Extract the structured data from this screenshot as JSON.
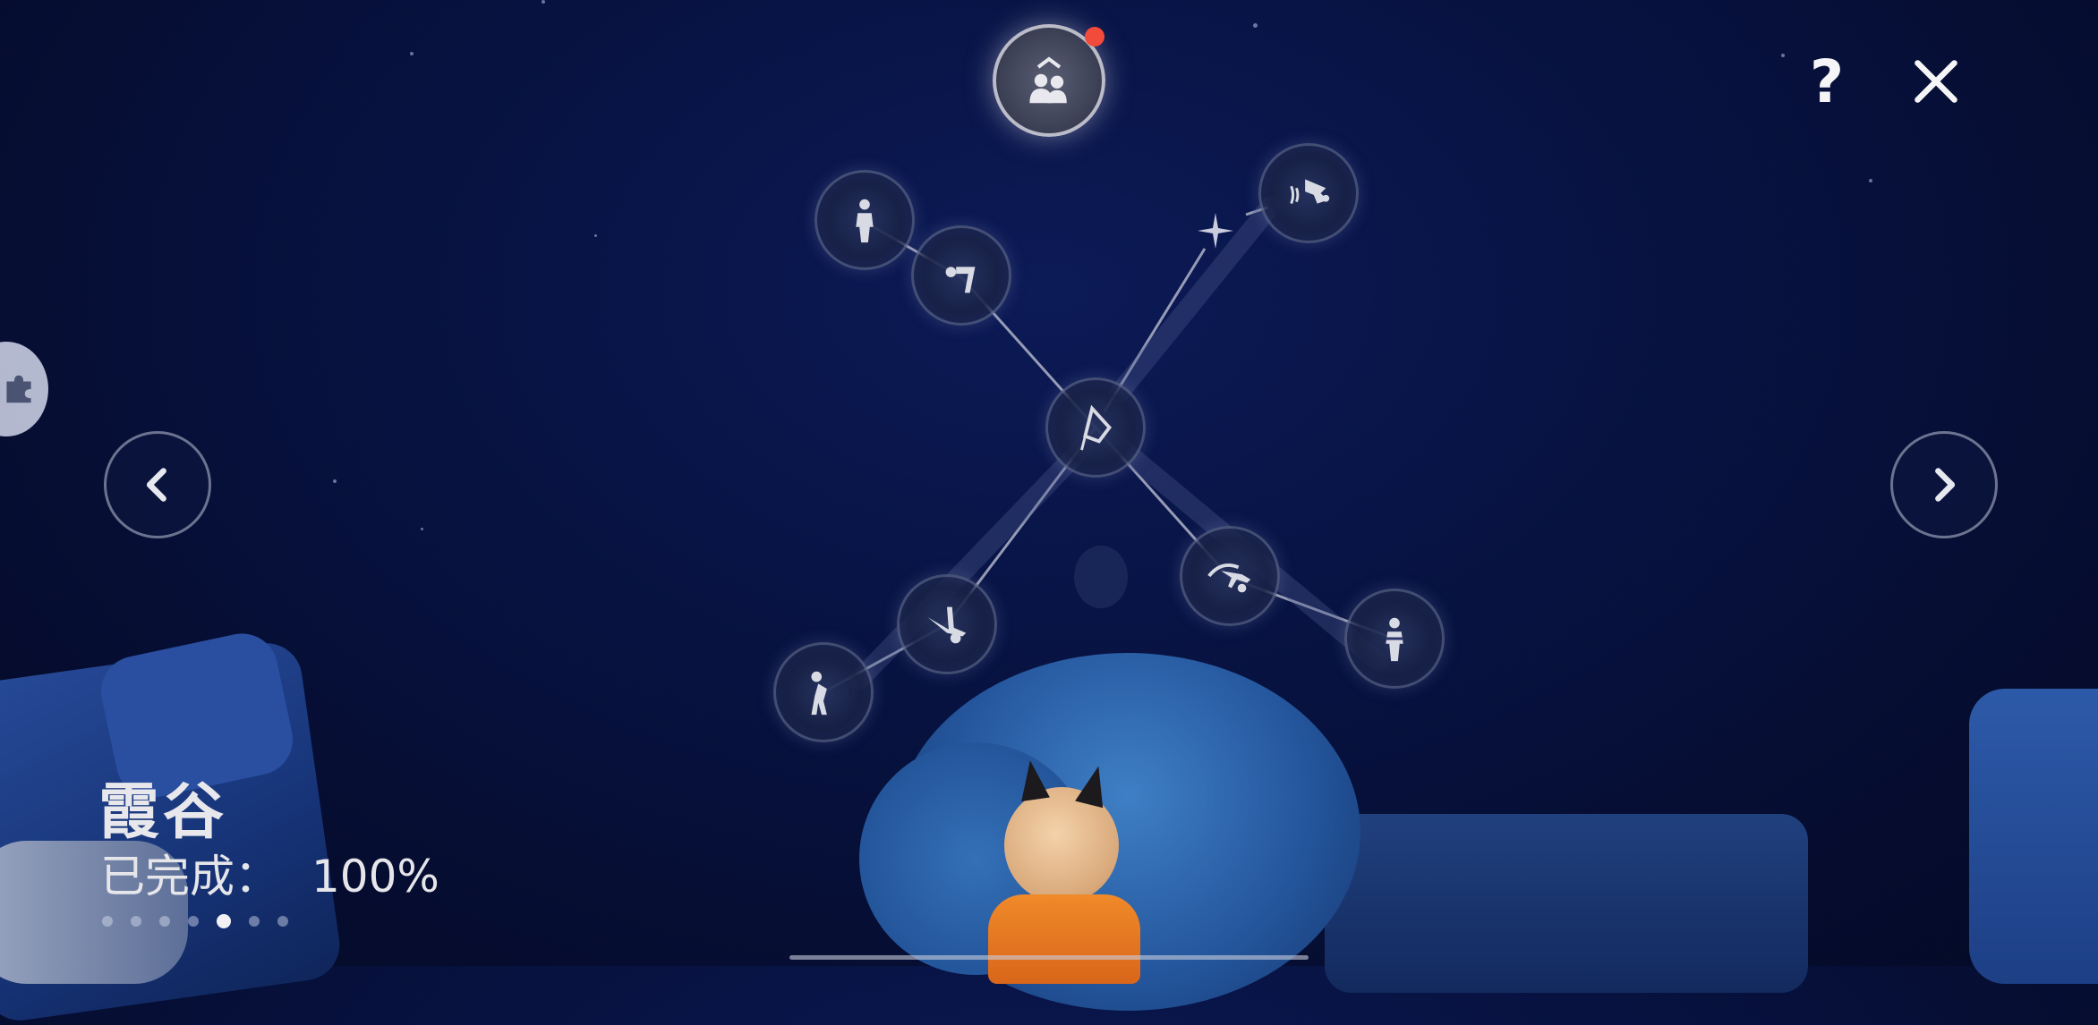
{
  "area": {
    "name": "霞谷",
    "progress_label": "已完成：",
    "progress_value": "100%",
    "progress_fraction": 1.0
  },
  "pager": {
    "count": 7,
    "active_index": 4
  },
  "top_button": {
    "icon": "friends-icon",
    "has_notification": true,
    "notification_color": "#f24a3b"
  },
  "constellation": {
    "nodes": [
      {
        "id": "spirit-standing",
        "icon": "standing-person-icon"
      },
      {
        "id": "spirit-bow",
        "icon": "bowing-person-icon"
      },
      {
        "id": "spirit-dance",
        "icon": "dancing-spirit-icon"
      },
      {
        "id": "spirit-center",
        "icon": "cape-emblem-icon"
      },
      {
        "id": "spirit-cartwheel",
        "icon": "cartwheel-icon"
      },
      {
        "id": "spirit-stretch",
        "icon": "stretching-person-icon"
      },
      {
        "id": "spirit-backflip",
        "icon": "backflip-icon"
      },
      {
        "id": "spirit-crossed-arms",
        "icon": "crossed-arms-person-icon"
      }
    ],
    "star_marker": "star-icon"
  },
  "controls": {
    "help": "?",
    "close": "close-icon",
    "prev": "chevron-left-icon",
    "next": "chevron-right-icon",
    "side_tab": "puzzle-icon"
  },
  "colors": {
    "sky_top": "#0c1a56",
    "sky_bottom": "#040a26",
    "cape": "#e8791f",
    "node_ring": "#9aa0be"
  }
}
